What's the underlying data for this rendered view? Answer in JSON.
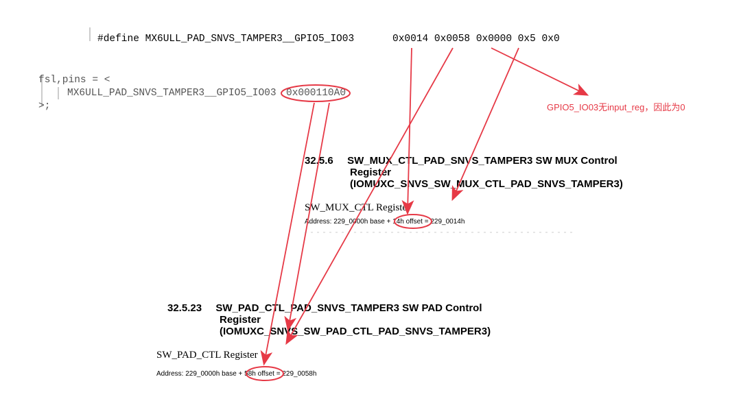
{
  "code": {
    "define_line": "#define MX6ULL_PAD_SNVS_TAMPER3__GPIO5_IO03",
    "hex_values": "0x0014 0x0058 0x0000 0x5 0x0",
    "line1": "fsl,pins = <",
    "line2_prefix": "MX6ULL_PAD_SNVS_TAMPER3__GPIO5_IO03",
    "line2_value": "0x000110A0",
    "line3": ">;"
  },
  "annotation": "GPIO5_IO03无input_reg，因此为0",
  "doc1": {
    "section": "32.5.6",
    "title_l1": "SW_MUX_CTL_PAD_SNVS_TAMPER3 SW MUX Control",
    "title_l2": "Register",
    "title_l3": "(IOMUXC_SNVS_SW_MUX_CTL_PAD_SNVS_TAMPER3)",
    "subtitle": "SW_MUX_CTL Register",
    "addr_prefix": "Address: 229_0000h base +",
    "addr_offset": "14h offset",
    "addr_suffix": "= 229_0014h"
  },
  "doc2": {
    "section": "32.5.23",
    "title_l1": "SW_PAD_CTL_PAD_SNVS_TAMPER3 SW PAD Control",
    "title_l2": "Register",
    "title_l3": "(IOMUXC_SNVS_SW_PAD_CTL_PAD_SNVS_TAMPER3)",
    "subtitle": "SW_PAD_CTL Register",
    "addr_prefix": "Address: 229_0000h base +",
    "addr_offset": "58h offset",
    "addr_suffix": "= 229_0058h"
  }
}
